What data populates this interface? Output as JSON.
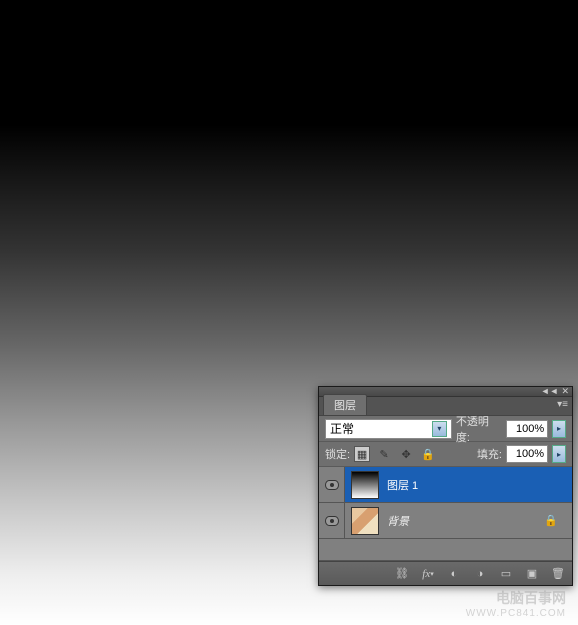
{
  "panel": {
    "tab_label": "图层",
    "blend_mode": "正常",
    "opacity_label": "不透明度:",
    "opacity_value": "100%",
    "lock_label": "锁定:",
    "fill_label": "填充:",
    "fill_value": "100%"
  },
  "layers": [
    {
      "name": "图层 1",
      "selected": true,
      "locked": false
    },
    {
      "name": "背景",
      "selected": false,
      "locked": true
    }
  ],
  "watermark": {
    "line1": "电脑百事网",
    "line2": "WWW.PC841.COM"
  }
}
